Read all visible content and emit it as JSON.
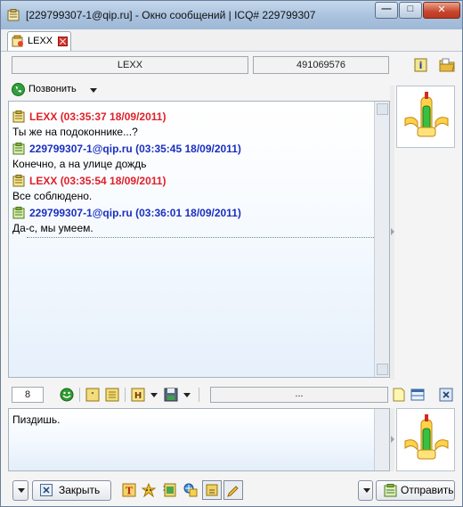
{
  "window": {
    "title": "[229799307-1@qip.ru] - Окно сообщений | ICQ# 229799307",
    "buttons": {
      "minimize": "—",
      "maximize": "□",
      "close": "✕"
    }
  },
  "tab": {
    "label": "LEXX"
  },
  "contact": {
    "name": "LEXX",
    "uin": "491069576"
  },
  "call": {
    "label": "Позвонить"
  },
  "messages": [
    {
      "sender": "LEXX",
      "meta": "(03:35:37 18/09/2011)",
      "text": "Ты же на подоконнике...?",
      "color": "#e0202a"
    },
    {
      "sender": "229799307-1@qip.ru",
      "meta": "(03:35:45 18/09/2011)",
      "text": "Конечно, а на улице дождь",
      "color": "#1a2fc0"
    },
    {
      "sender": "LEXX",
      "meta": "(03:35:54 18/09/2011)",
      "text": "Все соблюдено.",
      "color": "#e0202a"
    },
    {
      "sender": "229799307-1@qip.ru",
      "meta": "(03:36:01 18/09/2011)",
      "text": "Да-с, мы умеем.",
      "color": "#1a2fc0"
    }
  ],
  "toolbar": {
    "char_count": "8",
    "status_field": "..."
  },
  "input": {
    "text": "Пиздишь."
  },
  "bottom": {
    "close_label": "Закрыть",
    "send_label": "Отправить"
  }
}
